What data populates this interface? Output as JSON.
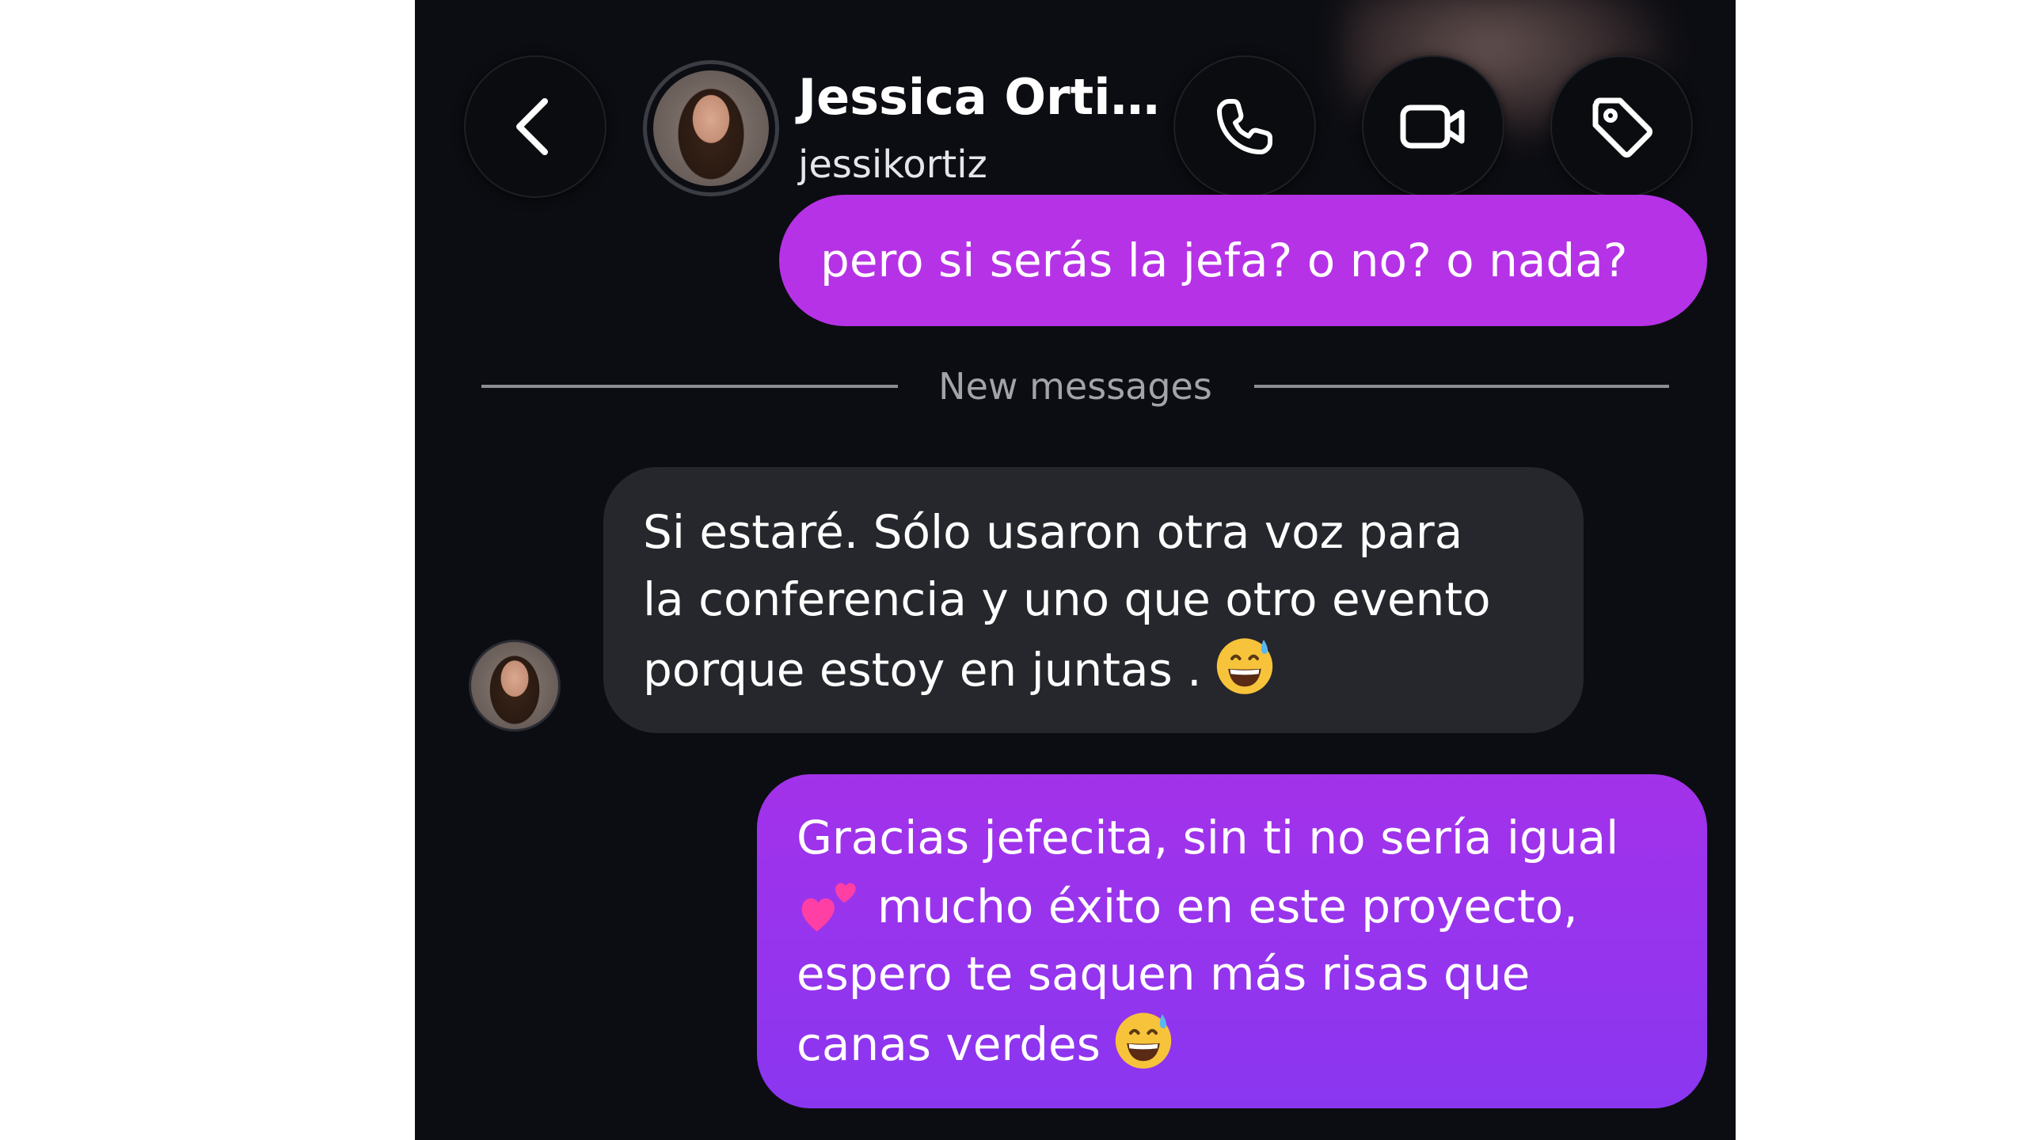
{
  "header": {
    "contact_name": "Jessica Orti…",
    "contact_username": "jessikortiz",
    "back_icon": "chevron-left-icon",
    "call_icon": "phone-icon",
    "video_icon": "video-camera-icon",
    "tag_icon": "tag-icon"
  },
  "messages": {
    "outgoing_1": "pero si serás la jefa? o no? o nada?",
    "divider_label": "New messages",
    "incoming_1": {
      "line1": "Si estaré. Sólo usaron otra voz para",
      "line2": "la conferencia y uno que otro evento",
      "line3": "porque estoy en juntas .",
      "emoji": "grinning-face-with-sweat-emoji"
    },
    "outgoing_2": {
      "line1": "Gracias jefecita, sin ti no sería igual",
      "line2": "mucho éxito en este proyecto,",
      "line3": "espero te saquen más risas que",
      "line4": "canas verdes",
      "emoji_hearts": "two-hearts-emoji",
      "emoji_end": "grinning-face-with-sweat-emoji"
    }
  },
  "colors": {
    "background": "#0c0d12",
    "outgoing_bubble": "#b632e6",
    "outgoing_bubble_2": "#8a36f0",
    "incoming_bubble": "#26272d",
    "divider": "#8d8e94"
  }
}
